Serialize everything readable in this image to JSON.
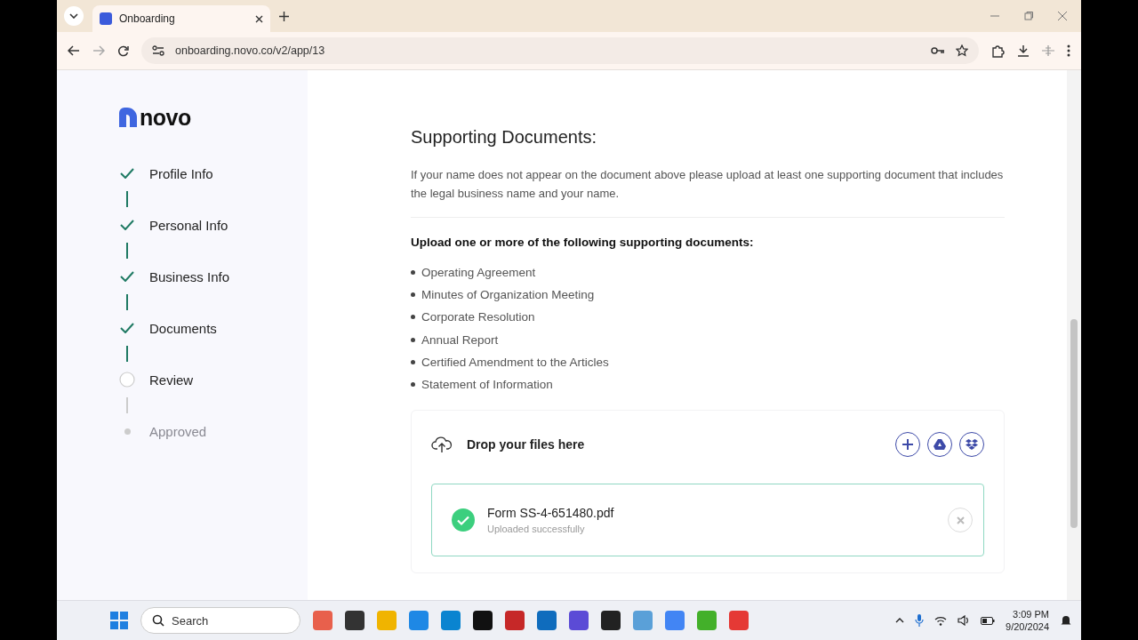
{
  "browser": {
    "tab_title": "Onboarding",
    "url": "onboarding.novo.co/v2/app/13"
  },
  "sidebar": {
    "logo": "novo",
    "steps": [
      {
        "label": "Profile Info",
        "completed": true,
        "disabled": false
      },
      {
        "label": "Personal Info",
        "completed": true,
        "disabled": false
      },
      {
        "label": "Business Info",
        "completed": true,
        "disabled": false
      },
      {
        "label": "Documents",
        "completed": true,
        "disabled": false
      },
      {
        "label": "Review",
        "completed": false,
        "disabled": false
      },
      {
        "label": "Approved",
        "completed": false,
        "disabled": true
      }
    ]
  },
  "content": {
    "title": "Supporting Documents:",
    "description": "If your name does not appear on the document above please upload at least one supporting document that includes the legal business name and your name.",
    "list_heading": "Upload one or more of the following supporting documents:",
    "documents": [
      "Operating Agreement",
      "Minutes of Organization Meeting",
      "Corporate Resolution",
      "Annual Report",
      "Certified Amendment to the Articles",
      "Statement of Information"
    ],
    "dropzone": {
      "label": "Drop your files here",
      "files": [
        {
          "name": "Form SS-4-651480.pdf",
          "status": "Uploaded successfully"
        }
      ]
    }
  },
  "taskbar": {
    "search_placeholder": "Search",
    "time": "3:09 PM",
    "date": "9/20/2024"
  }
}
